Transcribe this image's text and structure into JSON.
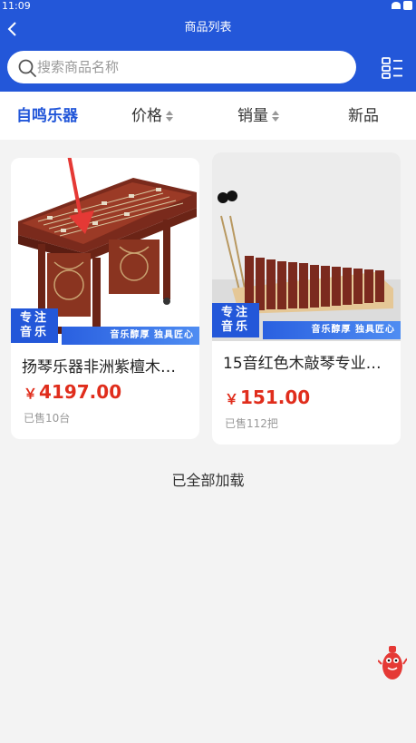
{
  "status_bar": {
    "time": "11:09"
  },
  "header": {
    "title": "商品列表"
  },
  "search": {
    "placeholder": "搜索商品名称"
  },
  "sort_tabs": [
    {
      "label": "自鸣乐器",
      "active": true
    },
    {
      "label": "价格",
      "sortable": true
    },
    {
      "label": "销量",
      "sortable": true
    },
    {
      "label": "新品"
    }
  ],
  "products": [
    {
      "name": "扬琴乐器非洲紫檀木…",
      "currency": "￥",
      "price": "4197.00",
      "sold": "已售10台",
      "badge_line1": "专注",
      "badge_line2": "音乐",
      "slogan": "音乐醇厚  独具匠心"
    },
    {
      "name": "15音红色木敲琴专业…",
      "currency": "￥",
      "price": "151.00",
      "sold": "已售112把",
      "badge_line1": "专注",
      "badge_line2": "音乐",
      "slogan": "音乐醇厚  独具匠心"
    }
  ],
  "footer": {
    "all_loaded": "已全部加载"
  },
  "colors": {
    "brand": "#2357d9",
    "price": "#e02d1c",
    "background": "#f3f3f3"
  },
  "icons": [
    "back-icon",
    "search-icon",
    "grid-view-icon",
    "mascot-icon"
  ]
}
